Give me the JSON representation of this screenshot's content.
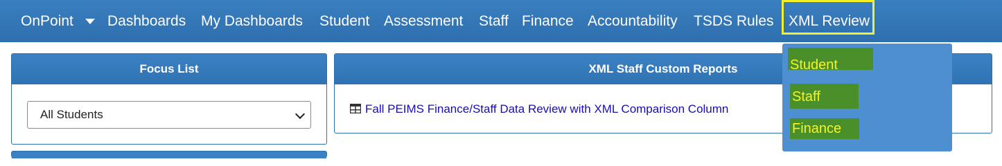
{
  "navbar": {
    "brand": "OnPoint",
    "items": [
      "Dashboards",
      "My Dashboards",
      "Student",
      "Assessment",
      "Staff",
      "Finance",
      "Accountability",
      "TSDS Rules",
      "XML Review"
    ]
  },
  "focus_list": {
    "title": "Focus List",
    "selected": "All Students"
  },
  "xml_staff_reports": {
    "title": "XML Staff Custom Reports",
    "link": "Fall PEIMS Finance/Staff Data Review with XML Comparison Column",
    "link_icon": "table-icon"
  },
  "xml_review_menu": {
    "items": [
      "Student",
      "Staff",
      "Finance"
    ],
    "highlight_color": "#f3f02a",
    "item_bg": "#4a8f2a",
    "item_text_color": "#f6f421"
  },
  "colors": {
    "nav_bg": "#2e6fae",
    "panel_header": "#3b82c4",
    "link": "#1a0dab"
  }
}
